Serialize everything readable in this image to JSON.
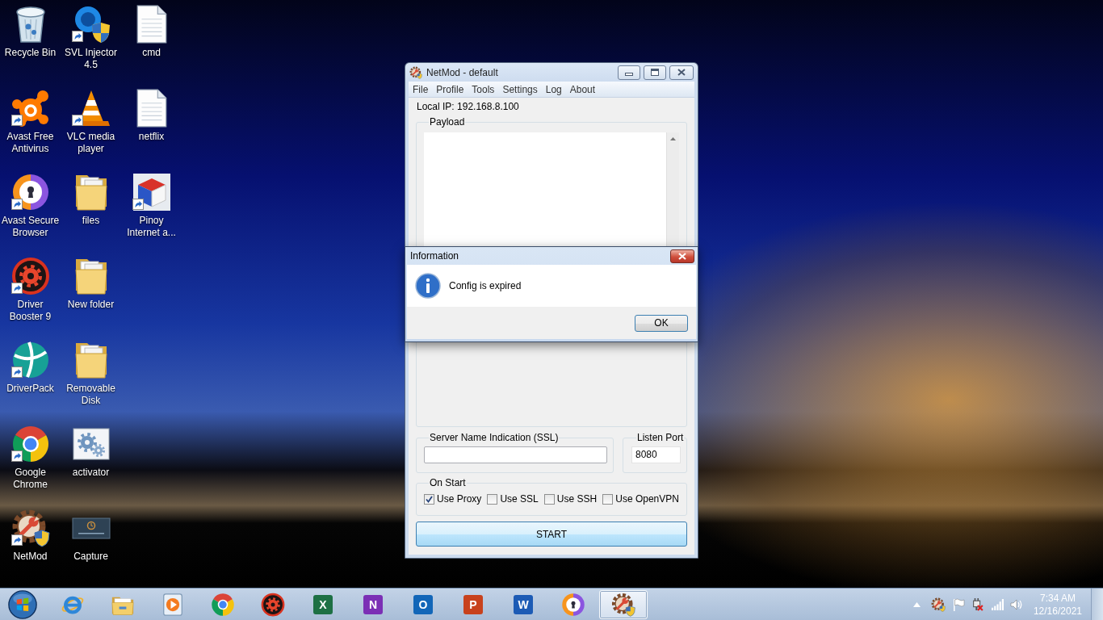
{
  "desktop_icons": [
    {
      "label": "Recycle Bin",
      "kind": "bin",
      "shortcut": false
    },
    {
      "label": "Avast Free Antivirus",
      "kind": "avast",
      "shortcut": true
    },
    {
      "label": "Avast Secure Browser",
      "kind": "browser",
      "shortcut": true
    },
    {
      "label": "Driver Booster 9",
      "kind": "booster",
      "shortcut": true
    },
    {
      "label": "DriverPack",
      "kind": "driverpack",
      "shortcut": true
    },
    {
      "label": "Google Chrome",
      "kind": "chrome",
      "shortcut": true
    },
    {
      "label": "NetMod",
      "kind": "netmod",
      "shortcut": true
    },
    {
      "label": "SVL Injector 4.5",
      "kind": "svl",
      "shortcut": true
    },
    {
      "label": "VLC media player",
      "kind": "cone",
      "shortcut": true
    },
    {
      "label": "files",
      "kind": "folder",
      "shortcut": false
    },
    {
      "label": "New folder",
      "kind": "folder",
      "shortcut": false
    },
    {
      "label": "Removable Disk",
      "kind": "folder",
      "shortcut": false
    },
    {
      "label": "activator",
      "kind": "gears",
      "shortcut": false
    },
    {
      "label": "Capture",
      "kind": "screenshot",
      "shortcut": false
    },
    {
      "label": "cmd",
      "kind": "document",
      "shortcut": false
    },
    {
      "label": "netflix",
      "kind": "document",
      "shortcut": false
    },
    {
      "label": "Pinoy Internet a...",
      "kind": "box",
      "shortcut": true
    }
  ],
  "netmod_window": {
    "title": "NetMod - default",
    "menu": [
      "File",
      "Profile",
      "Tools",
      "Settings",
      "Log",
      "About"
    ],
    "local_ip": "Local IP: 192.168.8.100",
    "payload": {
      "label": "Payload"
    },
    "sni": {
      "label": "Server Name Indication (SSL)"
    },
    "listen_port": {
      "label": "Listen Port",
      "value": "8080"
    },
    "on_start": {
      "label": "On Start",
      "options": [
        {
          "label": "Use Proxy",
          "checked": true
        },
        {
          "label": "Use SSL",
          "checked": false
        },
        {
          "label": "Use SSH",
          "checked": false
        },
        {
          "label": "Use OpenVPN",
          "checked": false
        }
      ]
    },
    "start_button": "START"
  },
  "dialog": {
    "title": "Information",
    "message": "Config is expired",
    "button": "OK"
  },
  "taskbar": {
    "apps": [
      {
        "kind": "ie",
        "selected": false
      },
      {
        "kind": "explorer",
        "selected": false
      },
      {
        "kind": "player",
        "selected": false
      },
      {
        "kind": "chrome",
        "selected": false
      },
      {
        "kind": "booster",
        "selected": false
      },
      {
        "kind": "tile",
        "letter": "X",
        "color": "#1d7044",
        "selected": false
      },
      {
        "kind": "tile",
        "letter": "N",
        "color": "#7b2fb5",
        "selected": false
      },
      {
        "kind": "tile",
        "letter": "O",
        "color": "#1266b8",
        "selected": false
      },
      {
        "kind": "tile",
        "letter": "P",
        "color": "#c8421d",
        "selected": false
      },
      {
        "kind": "tile",
        "letter": "W",
        "color": "#1c5bb5",
        "selected": false
      },
      {
        "kind": "browser",
        "selected": false
      },
      {
        "kind": "netmod",
        "selected": true
      }
    ],
    "clock": {
      "time": "7:34 AM",
      "date": "12/16/2021"
    }
  }
}
